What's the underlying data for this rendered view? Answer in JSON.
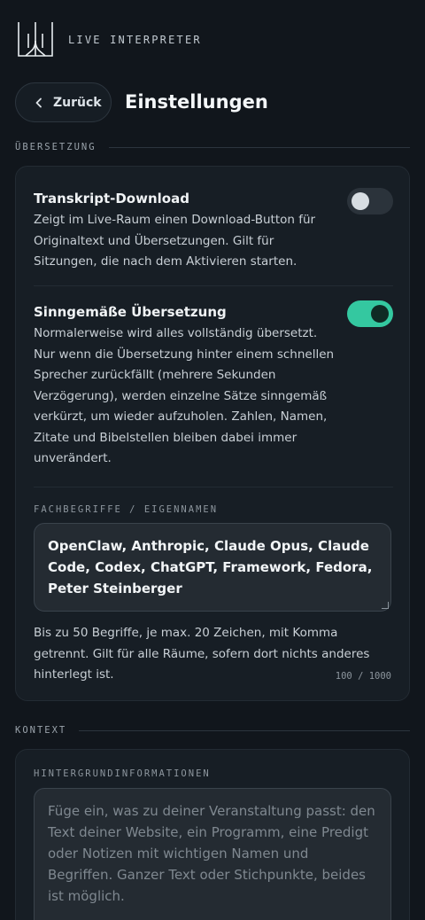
{
  "app": {
    "name": "LIVE INTERPRETER"
  },
  "header": {
    "back_label": "Zurück",
    "title": "Einstellungen"
  },
  "sections": {
    "translation": {
      "label": "ÜBERSETZUNG",
      "transcript": {
        "title": "Transkript-Download",
        "description": "Zeigt im Live-Raum einen Download-Button für Originaltext und Übersetzungen. Gilt für Sitzungen, die nach dem Aktivieren starten.",
        "enabled": false
      },
      "gist": {
        "title": "Sinngemäße Übersetzung",
        "description": "Normalerweise wird alles vollständig übersetzt. Nur wenn die Übersetzung hinter einem schnellen Sprecher zurückfällt (mehrere Sekunden Verzögerung), werden einzelne Sätze sinngemäß verkürzt, um wieder aufzuholen. Zahlen, Namen, Zitate und Bibelstellen bleiben dabei immer unverändert.",
        "enabled": true
      },
      "terms": {
        "label": "FACHBEGRIFFE / EIGENNAMEN",
        "value": "OpenClaw, Anthropic, Claude Opus, Claude Code, Codex, ChatGPT, Framework, Fedora,  Peter Steinberger",
        "hint": "Bis zu 50 Begriffe, je max. 20 Zeichen, mit Komma getrennt. Gilt für alle Räume, sofern dort nichts anderes hinterlegt ist.",
        "counter": "100 / 1000"
      }
    },
    "context": {
      "label": "KONTEXT",
      "background": {
        "label": "HINTERGRUNDINFORMATIONEN",
        "placeholder": "Füge ein, was zu deiner Veranstaltung passt: den Text deiner Website, ein Programm, eine Predigt oder Notizen mit wichtigen Namen und Begriffen. Ganzer Text oder Stichpunkte, beides ist möglich."
      }
    }
  },
  "colors": {
    "accent": "#34c8a0",
    "background": "#11161c",
    "card": "#171e25"
  },
  "icons": {
    "logo": "interpreter-logo",
    "back": "chevron-left-icon"
  }
}
